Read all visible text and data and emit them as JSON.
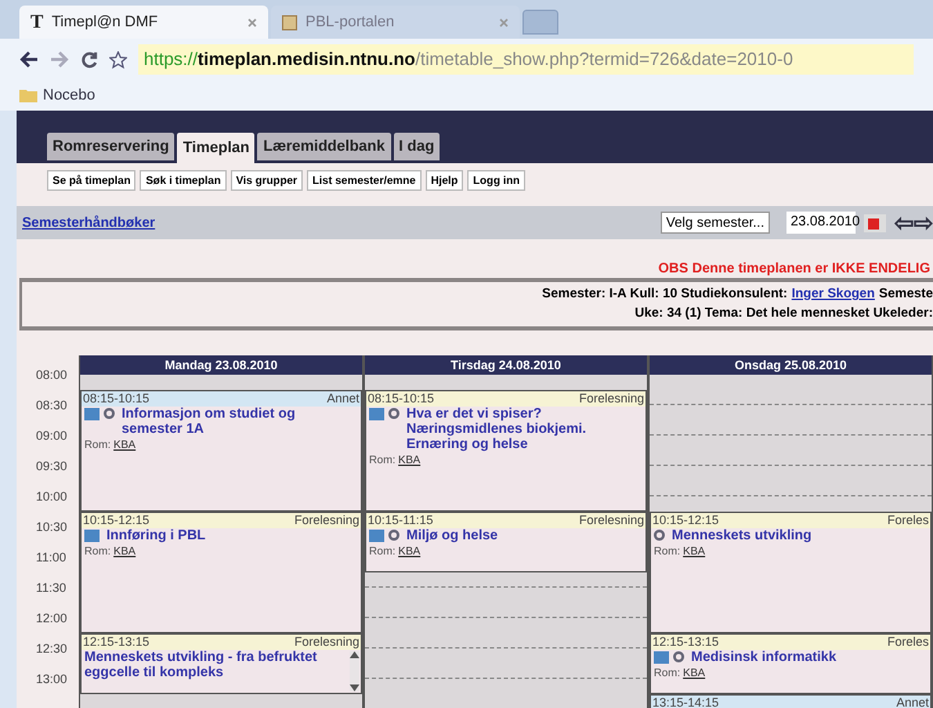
{
  "browser": {
    "tabs": [
      {
        "title": "Timepl@n DMF",
        "favicon": "T",
        "selected": true
      },
      {
        "title": "PBL-portalen",
        "selected": false
      }
    ],
    "address": {
      "scheme": "https://",
      "host": "timeplan.medisin.ntnu.no",
      "path": "/timetable_show.php?termid=726&date=2010-0"
    },
    "bookmarks": [
      "Nocebo"
    ]
  },
  "site_tabs": [
    {
      "label": "Romreservering",
      "selected": false
    },
    {
      "label": "Timeplan",
      "selected": true
    },
    {
      "label": "Læremiddelbank",
      "selected": false
    },
    {
      "label": "I dag",
      "selected": false
    }
  ],
  "subnav": [
    "Se på timeplan",
    "Søk i timeplan",
    "Vis grupper",
    "List semester/emne",
    "Hjelp",
    "Logg inn"
  ],
  "toolbar": {
    "link": "Semesterhåndbøker",
    "semester_select": "Velg semester...",
    "date": "23.08.2010",
    "arrows": "⇦⇨"
  },
  "notice": "OBS Denne timeplanen er IKKE ENDELIG",
  "info": {
    "line1_before": "Semester: I-A Kull: 10 Studiekonsulent:",
    "contact": "Inger Skogen",
    "line1_after": "Semeste",
    "line2": "Uke: 34 (1) Tema: Det hele mennesket Ukeleder:"
  },
  "times": [
    "08:00",
    "08:30",
    "09:00",
    "09:30",
    "10:00",
    "10:30",
    "11:00",
    "11:30",
    "12:00",
    "12:30",
    "13:00"
  ],
  "days": [
    {
      "label": "Mandag 23.08.2010",
      "events": [
        {
          "time": "08:15-10:15",
          "type": "Annet",
          "kind": "other",
          "calendar_icon": true,
          "comment_icon": true,
          "title": "Informasjon om studiet og semester 1A",
          "room_label": "Rom:",
          "room": "KBA",
          "scrollable": false
        },
        {
          "time": "10:15-12:15",
          "type": "Forelesning",
          "kind": "lecture",
          "calendar_icon": true,
          "comment_icon": false,
          "title": "Innføring i PBL",
          "room_label": "Rom:",
          "room": "KBA",
          "scrollable": false
        },
        {
          "time": "12:15-13:15",
          "type": "Forelesning",
          "kind": "lecture",
          "calendar_icon": false,
          "comment_icon": false,
          "title": "Menneskets utvikling - fra befruktet eggcelle til kompleks",
          "scrollable": true
        }
      ]
    },
    {
      "label": "Tirsdag 24.08.2010",
      "events": [
        {
          "time": "08:15-10:15",
          "type": "Forelesning",
          "kind": "lecture",
          "calendar_icon": true,
          "comment_icon": true,
          "title": "Hva er det vi spiser? Næringsmidlenes biokjemi. Ernæring og helse",
          "room_label": "Rom:",
          "room": "KBA",
          "scrollable": false
        },
        {
          "time": "10:15-11:15",
          "type": "Forelesning",
          "kind": "lecture",
          "calendar_icon": true,
          "comment_icon": true,
          "title": "Miljø og helse",
          "room_label": "Rom:",
          "room": "KBA",
          "scrollable": false
        }
      ]
    },
    {
      "label": "Onsdag 25.08.2010",
      "events": [
        {
          "time": "10:15-12:15",
          "type": "Foreles",
          "kind": "lecture",
          "calendar_icon": false,
          "comment_icon": true,
          "title": "Menneskets utvikling",
          "room_label": "Rom:",
          "room": "KBA",
          "scrollable": false
        },
        {
          "time": "12:15-13:15",
          "type": "Foreles",
          "kind": "lecture",
          "calendar_icon": true,
          "comment_icon": true,
          "title": "Medisinsk informatikk",
          "room_label": "Rom:",
          "room": "KBA",
          "scrollable": false
        },
        {
          "time": "13:15-14:15",
          "type": "Annet",
          "kind": "other",
          "calendar_icon": false,
          "comment_icon": false,
          "scrollable": false
        }
      ]
    }
  ]
}
